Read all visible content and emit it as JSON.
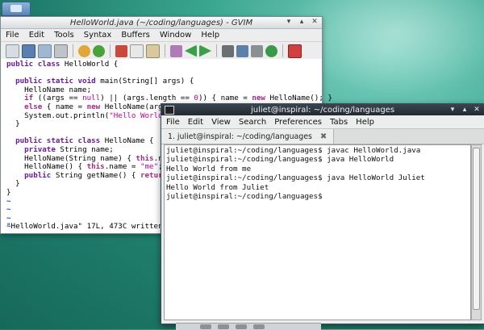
{
  "gvim": {
    "title": "HelloWorld.java (~/coding/languages) - GVIM",
    "menu": [
      "File",
      "Edit",
      "Tools",
      "Syntax",
      "Buffers",
      "Window",
      "Help"
    ],
    "status": "\"HelloWorld.java\" 17L, 473C written"
  },
  "terminal": {
    "title": "juliet@inspiral: ~/coding/languages",
    "menu": [
      "File",
      "Edit",
      "View",
      "Search",
      "Preferences",
      "Tabs",
      "Help"
    ],
    "tab_label": "1. juliet@inspiral: ~/coding/languages",
    "lines": [
      "juliet@inspiral:~/coding/languages$ javac HelloWorld.java",
      "juliet@inspiral:~/coding/languages$ java HelloWorld",
      "Hello World from me",
      "juliet@inspiral:~/coding/languages$ java HelloWorld Juliet",
      "Hello World from Juliet",
      "juliet@inspiral:~/coding/languages$"
    ]
  },
  "colors": {
    "keyword": "#a52a86",
    "string": "#c6009c",
    "tilde": "#1a3df0"
  }
}
